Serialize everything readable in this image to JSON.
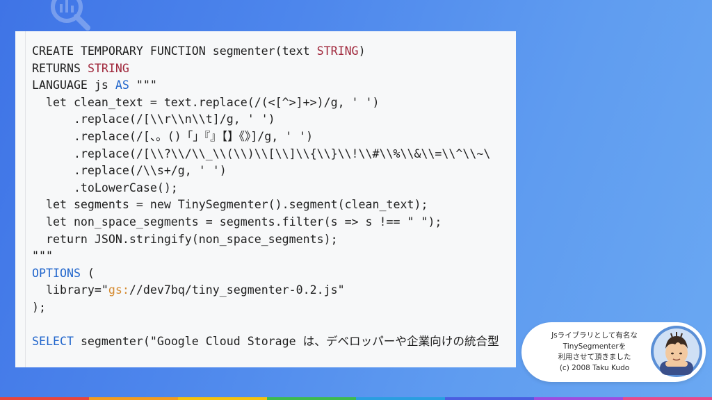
{
  "background": {
    "logo_icon": "bigquery-search-icon",
    "gradient_start": "#3f74e6",
    "gradient_end": "#6aa8f2"
  },
  "code": {
    "lines": [
      [
        {
          "t": "CREATE TEMPORARY FUNCTION segmenter(text ",
          "c": "kw"
        },
        {
          "t": "STRING",
          "c": "type"
        },
        {
          "t": ")",
          "c": "kw"
        }
      ],
      [
        {
          "t": "RETURNS ",
          "c": "kw"
        },
        {
          "t": "STRING",
          "c": "type"
        }
      ],
      [
        {
          "t": "LANGUAGE js ",
          "c": "kw"
        },
        {
          "t": "AS",
          "c": "blue"
        },
        {
          "t": " \"\"\"",
          "c": "kw"
        }
      ],
      [
        {
          "t": "  let clean_text = text.replace(/(<[^>]+>)/g, ' ')",
          "c": "kw"
        }
      ],
      [
        {
          "t": "      .replace(/[\\\\r\\\\n\\\\t]/g, ' ')",
          "c": "kw"
        }
      ],
      [
        {
          "t": "      .replace(/[、。()「」『』【】《》]/g, ' ')",
          "c": "kw"
        }
      ],
      [
        {
          "t": "      .replace(/[\\\\?\\\\/\\\\_\\\\(\\\\)\\\\[\\\\]\\\\{\\\\}\\\\!\\\\#\\\\%\\\\&\\\\=\\\\^\\\\~\\",
          "c": "kw"
        }
      ],
      [
        {
          "t": "      .replace(/\\\\s+/g, ' ')",
          "c": "kw"
        }
      ],
      [
        {
          "t": "      .toLowerCase();",
          "c": "kw"
        }
      ],
      [
        {
          "t": "  let segments = new TinySegmenter().segment(clean_text);",
          "c": "kw"
        }
      ],
      [
        {
          "t": "  let non_space_segments = segments.filter(s => s !== \" \");",
          "c": "kw"
        }
      ],
      [
        {
          "t": "  return JSON.stringify(non_space_segments);",
          "c": "kw"
        }
      ],
      [
        {
          "t": "\"\"\"",
          "c": "kw"
        }
      ],
      [
        {
          "t": "OPTIONS",
          "c": "blue"
        },
        {
          "t": " (",
          "c": "kw"
        }
      ],
      [
        {
          "t": "  library=\"",
          "c": "kw"
        },
        {
          "t": "gs:",
          "c": "orange"
        },
        {
          "t": "//dev7bq/tiny_segmenter-0.2.js\"",
          "c": "kw"
        }
      ],
      [
        {
          "t": ");",
          "c": "kw"
        }
      ],
      [
        {
          "t": "",
          "c": "kw"
        }
      ],
      [
        {
          "t": "SELECT",
          "c": "blue"
        },
        {
          "t": " segmenter(\"Google Cloud Storage は、デベロッパーや企業向けの統合型",
          "c": "kw"
        }
      ]
    ],
    "colors": {
      "kw": "#1f1f1f",
      "type": "#a0283c",
      "blue": "#2266cc",
      "orange": "#d58a2f"
    }
  },
  "credit": {
    "line1": "Jsライブラリとして有名な",
    "line2": "TinySegmenterを",
    "line3": "利用させて頂きました",
    "line4": "(c) 2008 Taku Kudo"
  },
  "avatar": {
    "icon": "presenter-avatar-icon"
  },
  "footer": {
    "stripe_colors": [
      "#e8453c",
      "#f29c1f",
      "#f4c20d",
      "#3dba4e",
      "#2a9ee0",
      "#4a5fe0",
      "#9b4de0",
      "#e84a8a"
    ]
  }
}
